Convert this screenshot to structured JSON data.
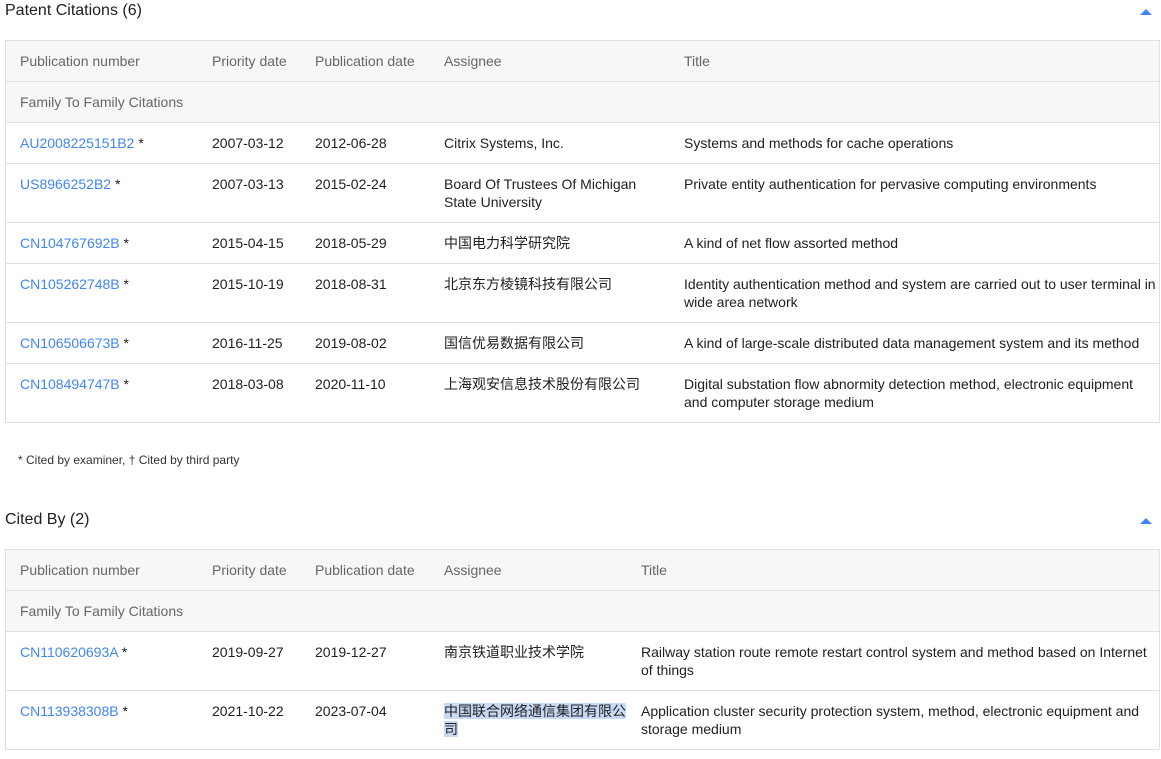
{
  "patent_citations": {
    "title": "Patent Citations (6)",
    "headers": [
      "Publication number",
      "Priority date",
      "Publication date",
      "Assignee",
      "Title"
    ],
    "family_label": "Family To Family Citations",
    "rows": [
      {
        "pub": "AU2008225151B2",
        "mark": "*",
        "priority": "2007-03-12",
        "published": "2012-06-28",
        "assignee": "Citrix Systems, Inc.",
        "title": "Systems and methods for cache operations"
      },
      {
        "pub": "US8966252B2",
        "mark": "*",
        "priority": "2007-03-13",
        "published": "2015-02-24",
        "assignee": "Board Of Trustees Of Michigan State University",
        "title": "Private entity authentication for pervasive computing environments"
      },
      {
        "pub": "CN104767692B",
        "mark": "*",
        "priority": "2015-04-15",
        "published": "2018-05-29",
        "assignee": "中国电力科学研究院",
        "title": "A kind of net flow assorted method"
      },
      {
        "pub": "CN105262748B",
        "mark": "*",
        "priority": "2015-10-19",
        "published": "2018-08-31",
        "assignee": "北京东方棱镜科技有限公司",
        "title": "Identity authentication method and system are carried out to user terminal in wide area network"
      },
      {
        "pub": "CN106506673B",
        "mark": "*",
        "priority": "2016-11-25",
        "published": "2019-08-02",
        "assignee": "国信优易数据有限公司",
        "title": "A kind of large-scale distributed data management system and its method"
      },
      {
        "pub": "CN108494747B",
        "mark": "*",
        "priority": "2018-03-08",
        "published": "2020-11-10",
        "assignee": "上海观安信息技术股份有限公司",
        "title": "Digital substation flow abnormity detection method, electronic equipment and computer storage medium"
      }
    ],
    "footnote": "* Cited by examiner, † Cited by third party"
  },
  "cited_by": {
    "title": "Cited By (2)",
    "headers": [
      "Publication number",
      "Priority date",
      "Publication date",
      "Assignee",
      "Title"
    ],
    "family_label": "Family To Family Citations",
    "rows": [
      {
        "pub": "CN110620693A",
        "mark": "*",
        "priority": "2019-09-27",
        "published": "2019-12-27",
        "assignee": "南京铁道职业技术学院",
        "title": "Railway station route remote restart control system and method based on Internet of things"
      },
      {
        "pub": "CN113938308B",
        "mark": "*",
        "priority": "2021-10-22",
        "published": "2023-07-04",
        "assignee": "中国联合网络通信集团有限公司",
        "title": "Application cluster security protection system, method, electronic equipment and storage medium"
      }
    ]
  },
  "icons": {
    "collapse": "chevron-up-icon"
  },
  "colors": {
    "link": "#4285f4",
    "header_bg": "#f7f7f7",
    "selection": "#c7d9f5"
  }
}
